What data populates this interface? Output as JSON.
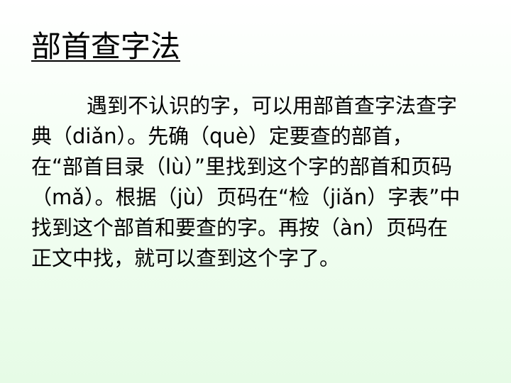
{
  "slide": {
    "title": "部首查字法",
    "body": "遇到不认识的字，可以用部首查字法查字典（diǎn）。先确（què）定要查的部首，在“部首目录（lù）”里找到这个字的部首和页码（mǎ）。根据（jù）页码在“检（jiǎn）字表”中找到这个部首和要查的字。再按（àn）页码在正文中找，就可以查到这个字了。"
  }
}
